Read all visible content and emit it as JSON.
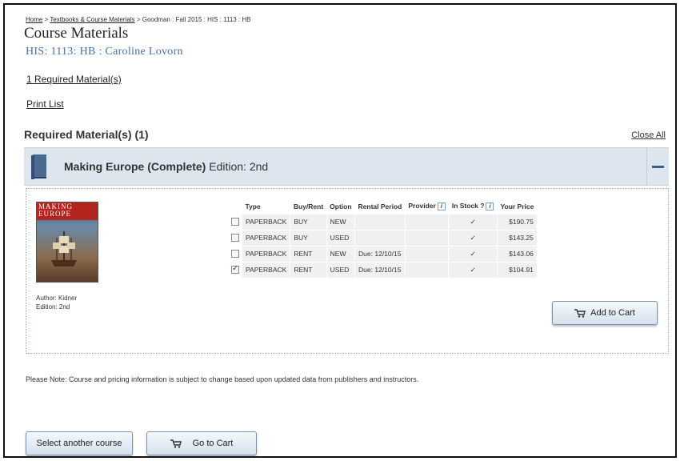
{
  "breadcrumb": {
    "home": "Home",
    "sep": ">",
    "textbooks": "Textbooks & Course Materials",
    "tail": "> Goodman : Fall 2015 : HIS : 1113 : HB"
  },
  "page_title": "Course Materials",
  "course_line": "HIS: 1113: HB : Caroline Lovorn",
  "required_link": "1 Required Material(s)",
  "print_link": "Print List",
  "section": {
    "heading": "Required Material(s) (1)",
    "close_all": "Close All"
  },
  "book": {
    "title": "Making Europe (Complete)",
    "edition_label": "Edition: 2nd",
    "cover_title_line1": "MAKING",
    "cover_title_line2": "EUROPE",
    "author": "Author: Kidner",
    "edition": "Edition: 2nd"
  },
  "table": {
    "headers": [
      "Type",
      "Buy/Rent",
      "Option",
      "Rental Period",
      "Provider",
      "In Stock ?",
      "Your Price"
    ],
    "rows": [
      {
        "checked": false,
        "type": "PAPERBACK",
        "buy_rent": "BUY",
        "option": "NEW",
        "rental_period": "",
        "provider": "",
        "in_stock": "✓",
        "price": "$190.75"
      },
      {
        "checked": false,
        "type": "PAPERBACK",
        "buy_rent": "BUY",
        "option": "USED",
        "rental_period": "",
        "provider": "",
        "in_stock": "✓",
        "price": "$143.25"
      },
      {
        "checked": false,
        "type": "PAPERBACK",
        "buy_rent": "RENT",
        "option": "NEW",
        "rental_period": "Due: 12/10/15",
        "provider": "",
        "in_stock": "✓",
        "price": "$143.06"
      },
      {
        "checked": true,
        "type": "PAPERBACK",
        "buy_rent": "RENT",
        "option": "USED",
        "rental_period": "Due: 12/10/15",
        "provider": "",
        "in_stock": "✓",
        "price": "$104.91"
      }
    ]
  },
  "buttons": {
    "add_to_cart": "Add to Cart",
    "select_course": "Select another course",
    "go_to_cart": "Go to Cart"
  },
  "note": "Please Note: Course and pricing information is subject to change based upon updated data from publishers and instructors.",
  "colors": {
    "accent": "#4a6fa5",
    "bar_bg": "#dde6ee",
    "collapse": "#3b5f87"
  }
}
